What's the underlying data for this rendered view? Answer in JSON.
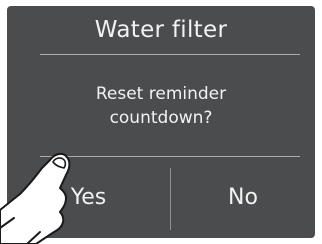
{
  "dialog": {
    "title": "Water filter",
    "message_line1": "Reset reminder",
    "message_line2": "countdown?",
    "yes_label": "Yes",
    "no_label": "No"
  },
  "colors": {
    "screen_background": "#4a4c4e",
    "text": "#f2f2f2",
    "divider": "#a9abad"
  },
  "icons": {
    "pointer": "tapping-hand-icon"
  }
}
